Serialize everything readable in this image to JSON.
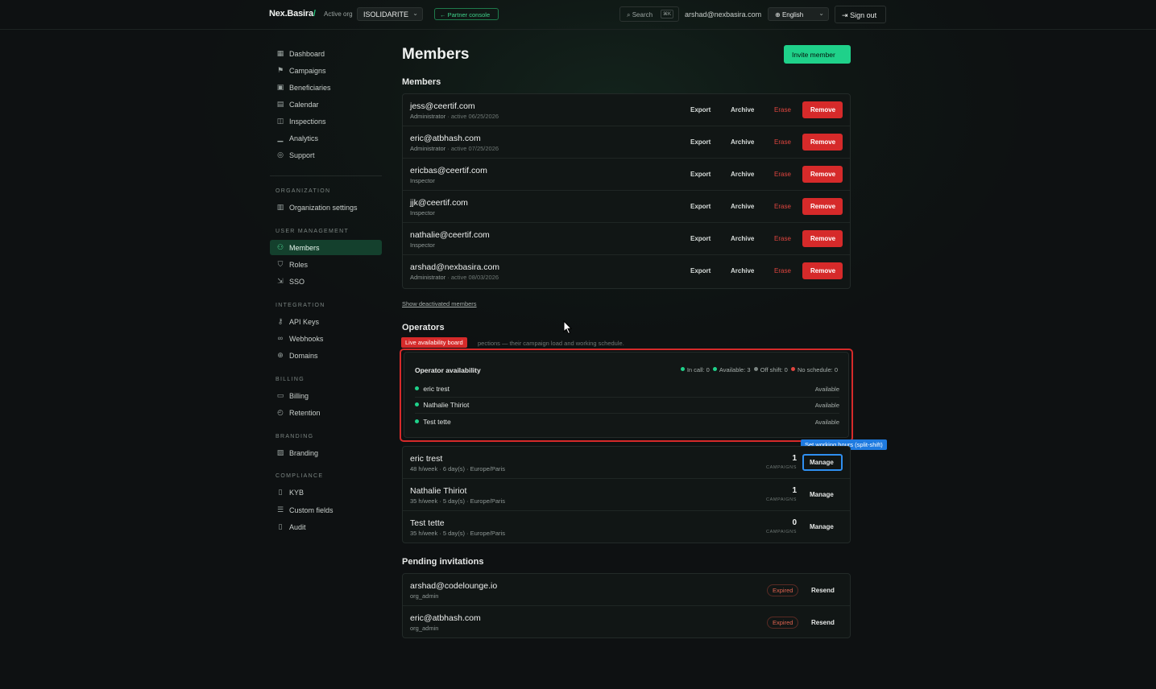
{
  "header": {
    "brand": "Nex.Basira",
    "brand_slash": "/",
    "active_org_label": "Active org",
    "org_value": "ISOLIDARITE",
    "partner_console": "← Partner console",
    "search_label": "Search",
    "search_kbd": "⌘K",
    "user_email": "arshad@nexbasira.com",
    "language": "English",
    "sign_out": "Sign out"
  },
  "sidebar": {
    "main": [
      {
        "label": "Dashboard",
        "icon": "dashboard-icon"
      },
      {
        "label": "Campaigns",
        "icon": "flag-icon"
      },
      {
        "label": "Beneficiaries",
        "icon": "id-card-icon"
      },
      {
        "label": "Calendar",
        "icon": "calendar-icon"
      },
      {
        "label": "Inspections",
        "icon": "camera-icon"
      },
      {
        "label": "Analytics",
        "icon": "bar-chart-icon"
      },
      {
        "label": "Support",
        "icon": "help-icon"
      }
    ],
    "sections": {
      "organization": {
        "title": "ORGANIZATION",
        "items": [
          "Organization settings"
        ]
      },
      "user_management": {
        "title": "USER MANAGEMENT",
        "items": [
          "Members",
          "Roles",
          "SSO"
        ]
      },
      "integration": {
        "title": "INTEGRATION",
        "items": [
          "API Keys",
          "Webhooks",
          "Domains"
        ]
      },
      "billing": {
        "title": "BILLING",
        "items": [
          "Billing",
          "Retention"
        ]
      },
      "branding": {
        "title": "BRANDING",
        "items": [
          "Branding"
        ]
      },
      "compliance": {
        "title": "COMPLIANCE",
        "items": [
          "KYB",
          "Custom fields",
          "Audit"
        ]
      }
    }
  },
  "page": {
    "title": "Members",
    "invite_button": "Invite member"
  },
  "members": {
    "heading": "Members",
    "actions": {
      "export": "Export",
      "archive": "Archive",
      "erase": "Erase",
      "remove": "Remove"
    },
    "rows": [
      {
        "email": "jess@ceertif.com",
        "role": "Administrator",
        "active": " · active 06/25/2026"
      },
      {
        "email": "eric@atbhash.com",
        "role": "Administrator",
        "active": " · active 07/25/2026"
      },
      {
        "email": "ericbas@ceertif.com",
        "role": "Inspector",
        "active": ""
      },
      {
        "email": "jjk@ceertif.com",
        "role": "Inspector",
        "active": ""
      },
      {
        "email": "nathalie@ceertif.com",
        "role": "Inspector",
        "active": ""
      },
      {
        "email": "arshad@nexbasira.com",
        "role": "Administrator",
        "active": " · active 08/03/2026"
      }
    ],
    "show_deactivated": "Show deactivated members"
  },
  "operators": {
    "heading": "Operators",
    "description": "pections — their campaign load and working schedule.",
    "live_badge": "Live availability board",
    "board": {
      "title": "Operator availability",
      "stats": {
        "in_call": "In call: 0",
        "available": "Available: 3",
        "off_shift": "Off shift: 0",
        "no_schedule": "No schedule: 0"
      },
      "colors": {
        "in_call": "#1fd18a",
        "available": "#1fd18a",
        "off_shift": "#7b8582",
        "no_schedule": "#e0453f"
      },
      "ops": [
        {
          "name": "eric trest",
          "status": "Available"
        },
        {
          "name": "Nathalie Thiriot",
          "status": "Available"
        },
        {
          "name": "Test tette",
          "status": "Available"
        }
      ]
    },
    "tooltip": "Set working hours (split-shift)",
    "campaigns_label": "CAMPAIGNS",
    "manage_label": "Manage",
    "rows": [
      {
        "name": "eric trest",
        "meta": "48 h/week · 6 day(s) · Europe/Paris",
        "campaigns": "1"
      },
      {
        "name": "Nathalie Thiriot",
        "meta": "35 h/week · 5 day(s) · Europe/Paris",
        "campaigns": "1"
      },
      {
        "name": "Test tette",
        "meta": "35 h/week · 5 day(s) · Europe/Paris",
        "campaigns": "0"
      }
    ]
  },
  "invitations": {
    "heading": "Pending invitations",
    "expired_label": "Expired",
    "resend_label": "Resend",
    "rows": [
      {
        "email": "arshad@codelounge.io",
        "role": "org_admin"
      },
      {
        "email": "eric@atbhash.com",
        "role": "org_admin"
      }
    ]
  },
  "theme": {
    "accent": "#1fd18a",
    "danger": "#d62a2a",
    "focus": "#2f8ff0"
  }
}
